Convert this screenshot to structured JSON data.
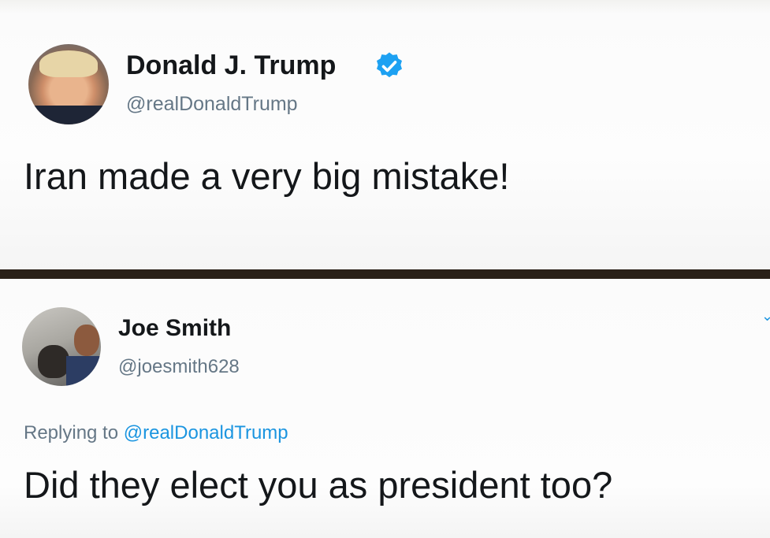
{
  "original_tweet": {
    "display_name": "Donald J. Trump",
    "handle": "@realDonaldTrump",
    "verified": true,
    "text": "Iran made a very big mistake!"
  },
  "reply_tweet": {
    "display_name": "Joe Smith",
    "handle": "@joesmith628",
    "replying_prefix": "Replying to",
    "replying_to": "@realDonaldTrump",
    "text": "Did they elect you as president too?"
  },
  "colors": {
    "divider": "#2a2118",
    "handle_gray": "#657786",
    "mention_blue": "#1b95e0",
    "verified_blue": "#1da1f2"
  }
}
